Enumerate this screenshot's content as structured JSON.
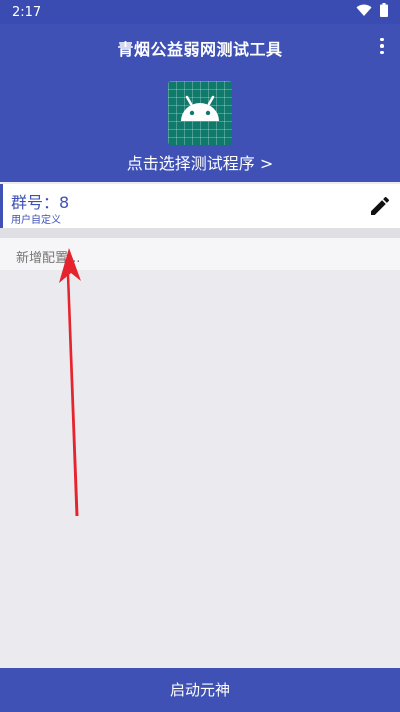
{
  "status_bar": {
    "time": "2:17",
    "icons": [
      "wifi-icon",
      "battery-icon"
    ]
  },
  "header": {
    "title": "青烟公益弱网测试工具",
    "menu_icon": "more-vert-icon",
    "app_icon": "android-icon",
    "select_program_label": "点击选择测试程序 >"
  },
  "config_list": {
    "items": [
      {
        "title": "群号：8",
        "subtitle": "用户自定义",
        "action_icon": "edit-pencil-icon"
      }
    ],
    "new_config_placeholder": "新增配置..."
  },
  "annotation": {
    "type": "red-arrow",
    "color": "#e5242d"
  },
  "bottom_bar": {
    "label": "启动元神"
  },
  "colors": {
    "primary": "#3f51b5",
    "status_bar": "#3a4cb1",
    "background": "#ebebef",
    "icon_green": "#0f7a6c",
    "arrow_red": "#e5242d"
  }
}
